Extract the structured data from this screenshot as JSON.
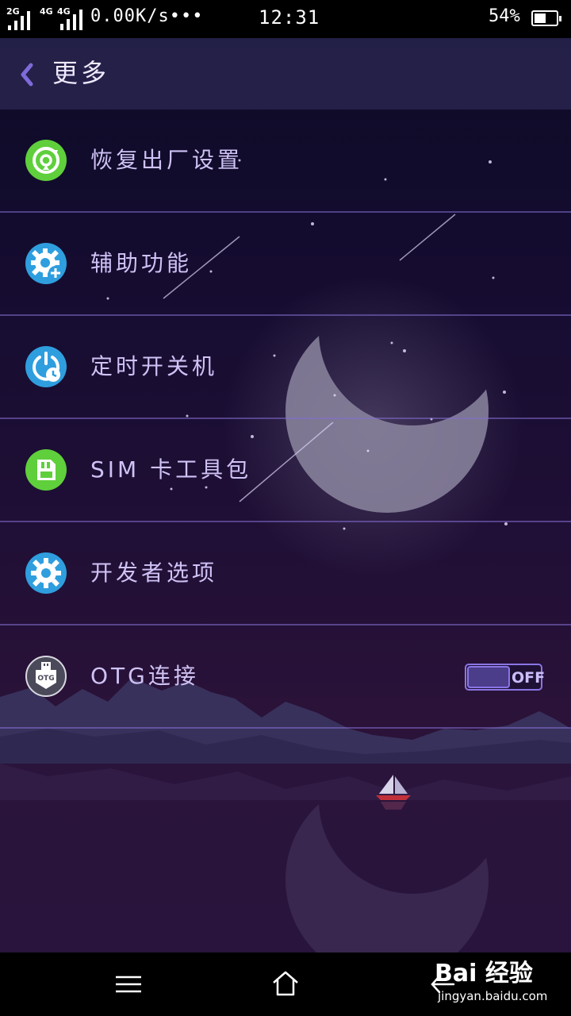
{
  "status_bar": {
    "sim1_type": "2G",
    "sim2_type_a": "4G",
    "sim2_type_b": "4G",
    "net_speed": "0.00K/s",
    "more_indicator": "•••",
    "time": "12:31",
    "battery_percent": "54%",
    "battery_level": 0.54
  },
  "header": {
    "back_icon": "chevron-left-icon",
    "title": "更多"
  },
  "menu": {
    "items": [
      {
        "label": "恢复出厂设置",
        "icon": "factory-reset-icon",
        "icon_color": "#5fcf3c"
      },
      {
        "label": "辅助功能",
        "icon": "accessibility-gear-icon",
        "icon_color": "#2f9ede"
      },
      {
        "label": "定时开关机",
        "icon": "scheduled-power-icon",
        "icon_color": "#2f9ede"
      },
      {
        "label": "SIM 卡工具包",
        "icon": "sim-card-icon",
        "icon_color": "#5fcf3c"
      },
      {
        "label": "开发者选项",
        "icon": "developer-gear-icon",
        "icon_color": "#2f9ede"
      },
      {
        "label": "OTG连接",
        "icon": "otg-usb-icon",
        "icon_color": "#4a4a5a",
        "toggle_state": "OFF"
      }
    ]
  },
  "nav_bar": {
    "menu_icon": "menu-icon",
    "home_icon": "home-icon"
  },
  "watermark": {
    "logo_text": "Bai 经验",
    "url": "jingyan.baidu.com"
  },
  "colors": {
    "accent": "#7e6ad8",
    "divider": "#8a6fd0",
    "label": "#cfc2f5"
  }
}
